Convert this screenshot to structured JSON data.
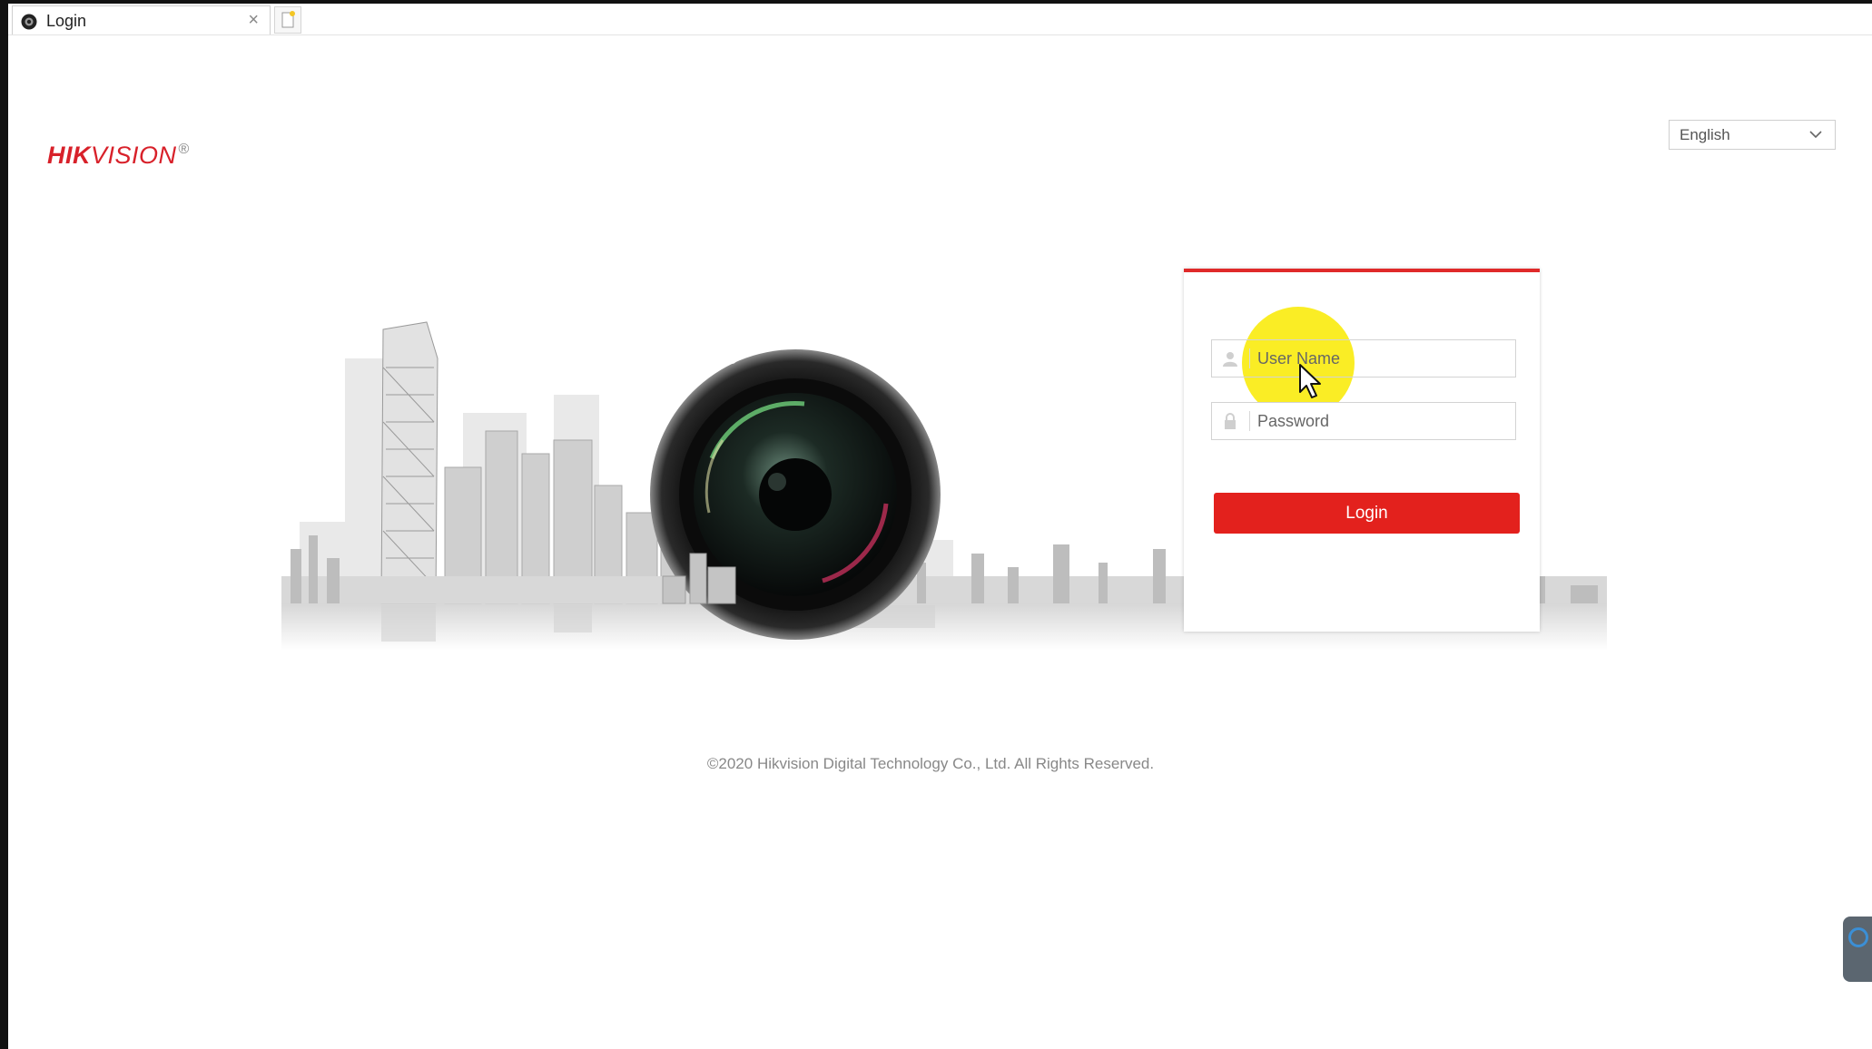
{
  "browser": {
    "tab_title": "Login",
    "tab_close": "×"
  },
  "header": {
    "logo_bold": "HIK",
    "logo_rest": "VISION",
    "logo_mark": "®",
    "language": "English"
  },
  "login": {
    "username_placeholder": "User Name",
    "password_placeholder": "Password",
    "login_label": "Login"
  },
  "footer": {
    "copyright": "©2020 Hikvision Digital Technology Co., Ltd. All Rights Reserved."
  },
  "icons": {
    "user": "user-icon",
    "lock": "lock-icon",
    "chevron": "chevron-down-icon",
    "close": "close-icon",
    "new_tab": "new-tab-icon"
  },
  "colors": {
    "brand_red": "#d8212a",
    "login_button": "#e3211d",
    "panel_border_top": "#e02a2a",
    "cursor_highlight": "#faec14"
  }
}
